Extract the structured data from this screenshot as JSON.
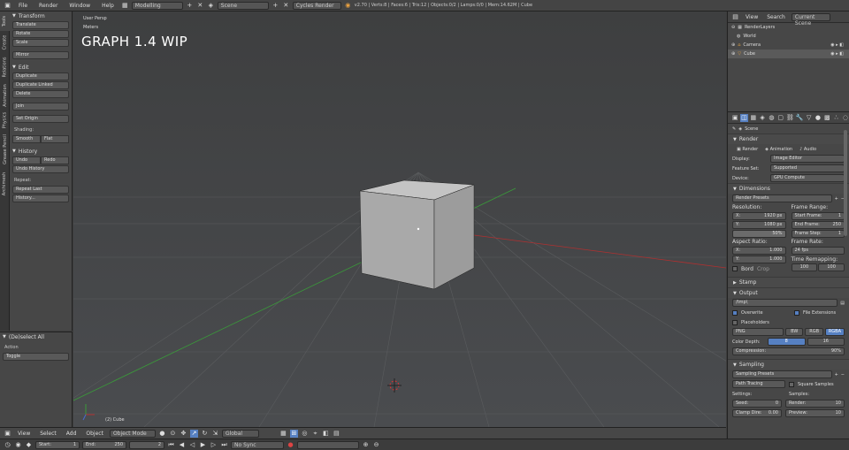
{
  "topbar": {
    "menus": [
      "File",
      "Render",
      "Window",
      "Help"
    ],
    "layout": "Modelling",
    "scene": "Scene",
    "engine": "Cycles Render",
    "stats": "v2.70 | Verts:8 | Faces:6 | Tris:12 | Objects:0/2 | Lamps:0/0 | Mem:14.62M | Cube"
  },
  "vtabs": [
    "Tools",
    "Create",
    "Relations",
    "Animation",
    "Physics",
    "Grease Pencil",
    "Archimesh"
  ],
  "tools": {
    "transform": {
      "title": "Transform",
      "items": [
        "Translate",
        "Rotate",
        "Scale",
        "Mirror"
      ]
    },
    "edit": {
      "title": "Edit",
      "items": [
        "Duplicate",
        "Duplicate Linked",
        "Delete"
      ],
      "join": "Join",
      "set_origin": "Set Origin",
      "shading": "Shading:",
      "smooth": "Smooth",
      "flat": "Flat"
    },
    "history": {
      "title": "History",
      "undo": "Undo",
      "redo": "Redo",
      "undo_history": "Undo History",
      "repeat": "Repeat:",
      "repeat_last": "Repeat Last",
      "history": "History..."
    }
  },
  "operator": {
    "title": "(De)select All",
    "action_label": "Action",
    "action_value": "Toggle"
  },
  "viewport": {
    "view_name": "User Persp",
    "units": "Meters",
    "title": "GRAPH 1.4 WIP",
    "object_label": "(2) Cube"
  },
  "view_header": {
    "menus": [
      "View",
      "Select",
      "Add",
      "Object"
    ],
    "mode": "Object Mode",
    "orientation": "Global"
  },
  "timeline": {
    "start_label": "Start:",
    "start": "1",
    "end_label": "End:",
    "end": "250",
    "frame": "2",
    "sync": "No Sync"
  },
  "outliner": {
    "menus": [
      "View",
      "Search"
    ],
    "display": "Current Scene",
    "items": [
      "RenderLayers",
      "World",
      "Camera",
      "Cube"
    ]
  },
  "props": {
    "breadcrumb": "Scene",
    "render": {
      "title": "Render",
      "tabs": [
        "Render",
        "Animation",
        "Audio"
      ],
      "display_label": "Display:",
      "display": "Image Editor",
      "feature_label": "Feature Set:",
      "feature": "Supported",
      "device_label": "Device:",
      "device": "GPU Compute"
    },
    "dimensions": {
      "title": "Dimensions",
      "presets": "Render Presets",
      "resolution": "Resolution:",
      "res_x": "1920 px",
      "res_y": "1080 px",
      "res_pct": "50%",
      "frame_range": "Frame Range:",
      "start_frame": "Start Frame:",
      "start_frame_v": "1",
      "end_frame": "End Frame:",
      "end_frame_v": "250",
      "frame_step": "Frame Step:",
      "frame_step_v": "1",
      "aspect": "Aspect Ratio:",
      "asp_x": "1.000",
      "asp_y": "1.000",
      "frame_rate": "Frame Rate:",
      "fps": "24 fps",
      "time_remap": "Time Remapping:",
      "remap_old": "100",
      "remap_new": "100",
      "border": "Bord",
      "crop": "Crop"
    },
    "stamp": "Stamp",
    "output": {
      "title": "Output",
      "path": "/tmp\\",
      "overwrite": "Overwrite",
      "file_ext": "File Extensions",
      "placeholders": "Placeholders",
      "format": "PNG",
      "bw": "BW",
      "rgb": "RGB",
      "rgba": "RGBA",
      "depth_label": "Color Depth:",
      "depth_a": "8",
      "depth_b": "16",
      "compression": "Compression:",
      "compression_v": "90%"
    },
    "sampling": {
      "title": "Sampling",
      "presets": "Sampling Presets",
      "method": "Path Tracing",
      "square": "Square Samples",
      "settings": "Settings:",
      "samples": "Samples:",
      "seed": "Seed:",
      "seed_v": "0",
      "render": "Render:",
      "render_v": "10",
      "clamp": "Clamp Dire:",
      "clamp_v": "0.00",
      "preview": "Preview:",
      "preview_v": "10"
    }
  },
  "colors": {
    "accent": "#5680c2",
    "axis_x": "#b03030",
    "axis_y": "#3a9a3a",
    "header": "#444444"
  }
}
